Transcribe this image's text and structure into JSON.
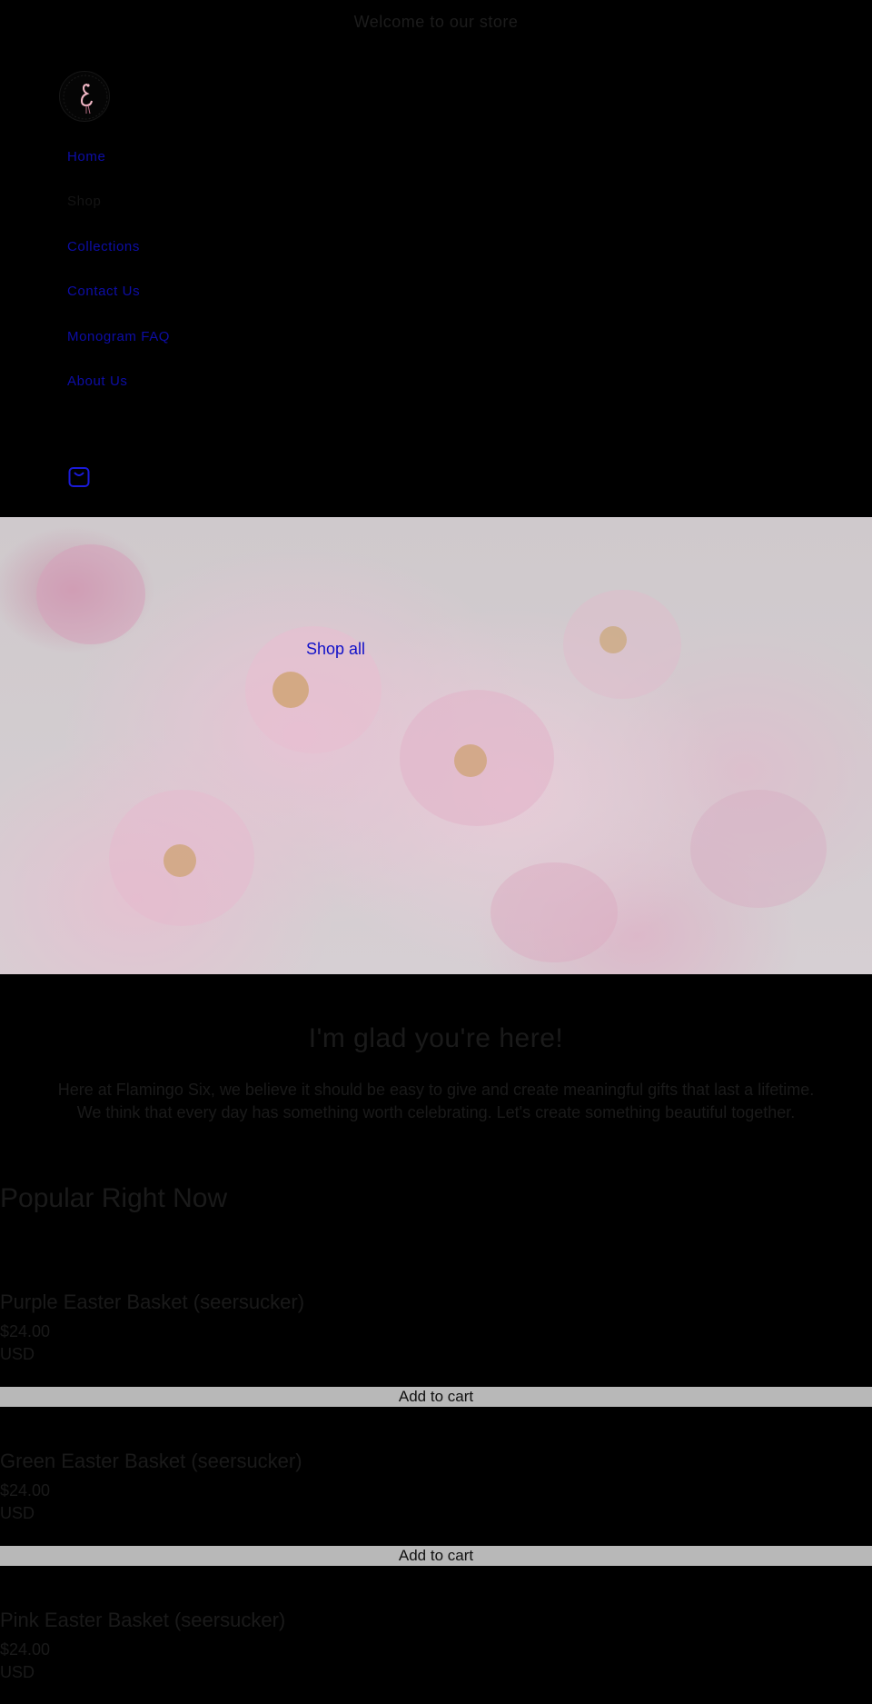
{
  "announcement": "Welcome to our store",
  "nav": {
    "items": [
      {
        "label": "Home",
        "active": true
      },
      {
        "label": "Shop",
        "active": false
      },
      {
        "label": "Collections",
        "active": true
      },
      {
        "label": "Contact Us",
        "active": true
      },
      {
        "label": "Monogram FAQ",
        "active": true
      },
      {
        "label": "About Us",
        "active": true
      }
    ]
  },
  "icons": {
    "logo": "flamingo-logo-icon",
    "cart": "shopping-bag-icon"
  },
  "hero": {
    "link_label": "Shop all"
  },
  "welcome": {
    "heading": "I'm glad you're here!",
    "text": "Here at Flamingo Six, we believe it should be easy to give and create meaningful gifts that last a lifetime. We think that every day has something worth celebrating. Let's create something beautiful together."
  },
  "popular": {
    "heading": "Popular Right Now",
    "products": [
      {
        "title": "Purple Easter Basket (seersucker)",
        "price": "$24.00",
        "currency": "USD",
        "button": "Add to cart"
      },
      {
        "title": "Green Easter Basket (seersucker)",
        "price": "$24.00",
        "currency": "USD",
        "button": "Add to cart"
      },
      {
        "title": "Pink Easter Basket (seersucker)",
        "price": "$24.00",
        "currency": "USD"
      }
    ]
  },
  "colors": {
    "background": "#000000",
    "link": "#1010c8",
    "button": "#b8b8b8"
  }
}
